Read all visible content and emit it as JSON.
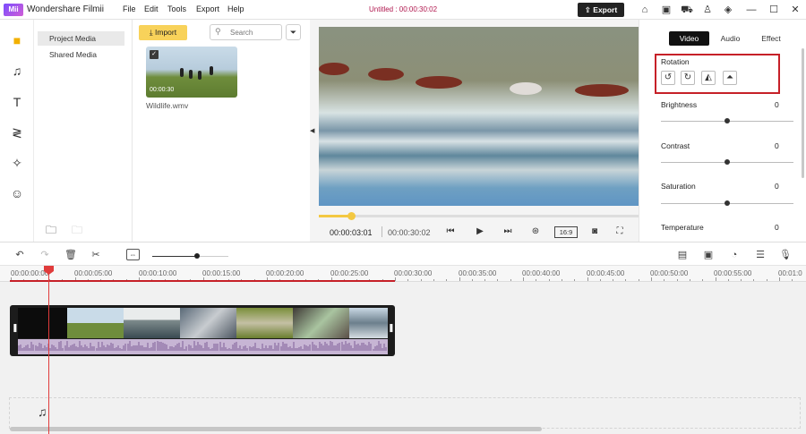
{
  "app": {
    "title": "Wondershare Filmii",
    "logo_text": "Mii",
    "project_title": "Untitled :  00:00:30:02",
    "menu": [
      "File",
      "Edit",
      "Tools",
      "Export",
      "Help"
    ],
    "export_label": "Export",
    "accent_color": "#f8d25a",
    "highlight_color": "#c62028"
  },
  "title_icons": [
    "home-icon",
    "save-icon",
    "cart-icon",
    "user-icon",
    "shirt-icon",
    "minimize-icon",
    "maximize-icon",
    "close-icon"
  ],
  "left_rail": [
    "media-folder-icon",
    "music-note-icon",
    "text-title-icon",
    "transition-icon",
    "effects-sparkle-icon",
    "sticker-smiley-icon"
  ],
  "media_nav": {
    "items": [
      "Project Media",
      "Shared Media"
    ]
  },
  "library": {
    "import_label": "Import",
    "search_placeholder": "Search",
    "item": {
      "filename": "Wildlife.wmv",
      "duration": "00:00:30",
      "selected": true
    }
  },
  "preview": {
    "current_time": "00:00:03:01",
    "total_time": "00:00:30:02",
    "aspect_ratio": "16:9",
    "progress": 0.1
  },
  "properties": {
    "tabs": [
      "Video",
      "Audio",
      "Effect"
    ],
    "active_tab": "Video",
    "rotation_label": "Rotation",
    "adjustments": [
      {
        "label": "Brightness",
        "value": "0"
      },
      {
        "label": "Contrast",
        "value": "0"
      },
      {
        "label": "Saturation",
        "value": "0"
      },
      {
        "label": "Temperature",
        "value": "0"
      }
    ]
  },
  "timeline": {
    "ruler_labels": [
      "00:00:00:00",
      "00:00:05:00",
      "00:00:10:00",
      "00:00:15:00",
      "00:00:20:00",
      "00:00:25:00",
      "00:00:30:00",
      "00:00:35:00",
      "00:00:40:00",
      "00:00:45:00",
      "00:00:50:00",
      "00:00:55:00",
      "00:01:0"
    ],
    "zoom_level": 0.6
  }
}
